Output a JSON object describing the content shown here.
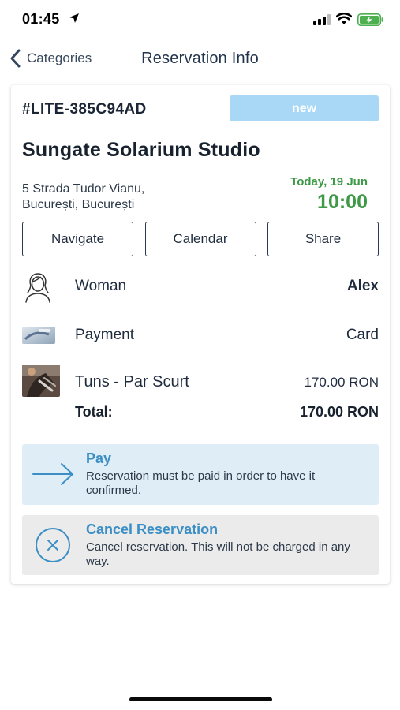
{
  "status_bar": {
    "time": "01:45",
    "icons": [
      "location-arrow-icon",
      "cellular-signal-icon",
      "wifi-icon",
      "battery-charging-icon"
    ]
  },
  "nav": {
    "back_label": "Categories",
    "title": "Reservation Info"
  },
  "reservation": {
    "id": "#LITE-385C94AD",
    "status": "new",
    "venue_name": "Sungate Solarium Studio",
    "address_line1": "5 Strada Tudor Vianu,",
    "address_line2": "București, București",
    "date": "Today, 19 Jun",
    "time": "10:00"
  },
  "actions": {
    "navigate": "Navigate",
    "calendar": "Calendar",
    "share": "Share"
  },
  "details": {
    "staff_label": "Woman",
    "staff_value": "Alex",
    "payment_label": "Payment",
    "payment_value": "Card",
    "service_label": "Tuns - Par Scurt",
    "service_price": "170.00 RON",
    "total_label": "Total:",
    "total_value": "170.00 RON"
  },
  "pay": {
    "title": "Pay",
    "text": "Reservation must be paid in order to have it confirmed."
  },
  "cancel": {
    "title": "Cancel Reservation",
    "text": "Cancel reservation. This will not be charged in any way."
  },
  "colors": {
    "accent_blue": "#3b8fc5",
    "badge_blue": "#a8d8f5",
    "time_green": "#3d9a46",
    "pay_bg": "#dfedf6",
    "cancel_bg": "#ebebeb"
  }
}
